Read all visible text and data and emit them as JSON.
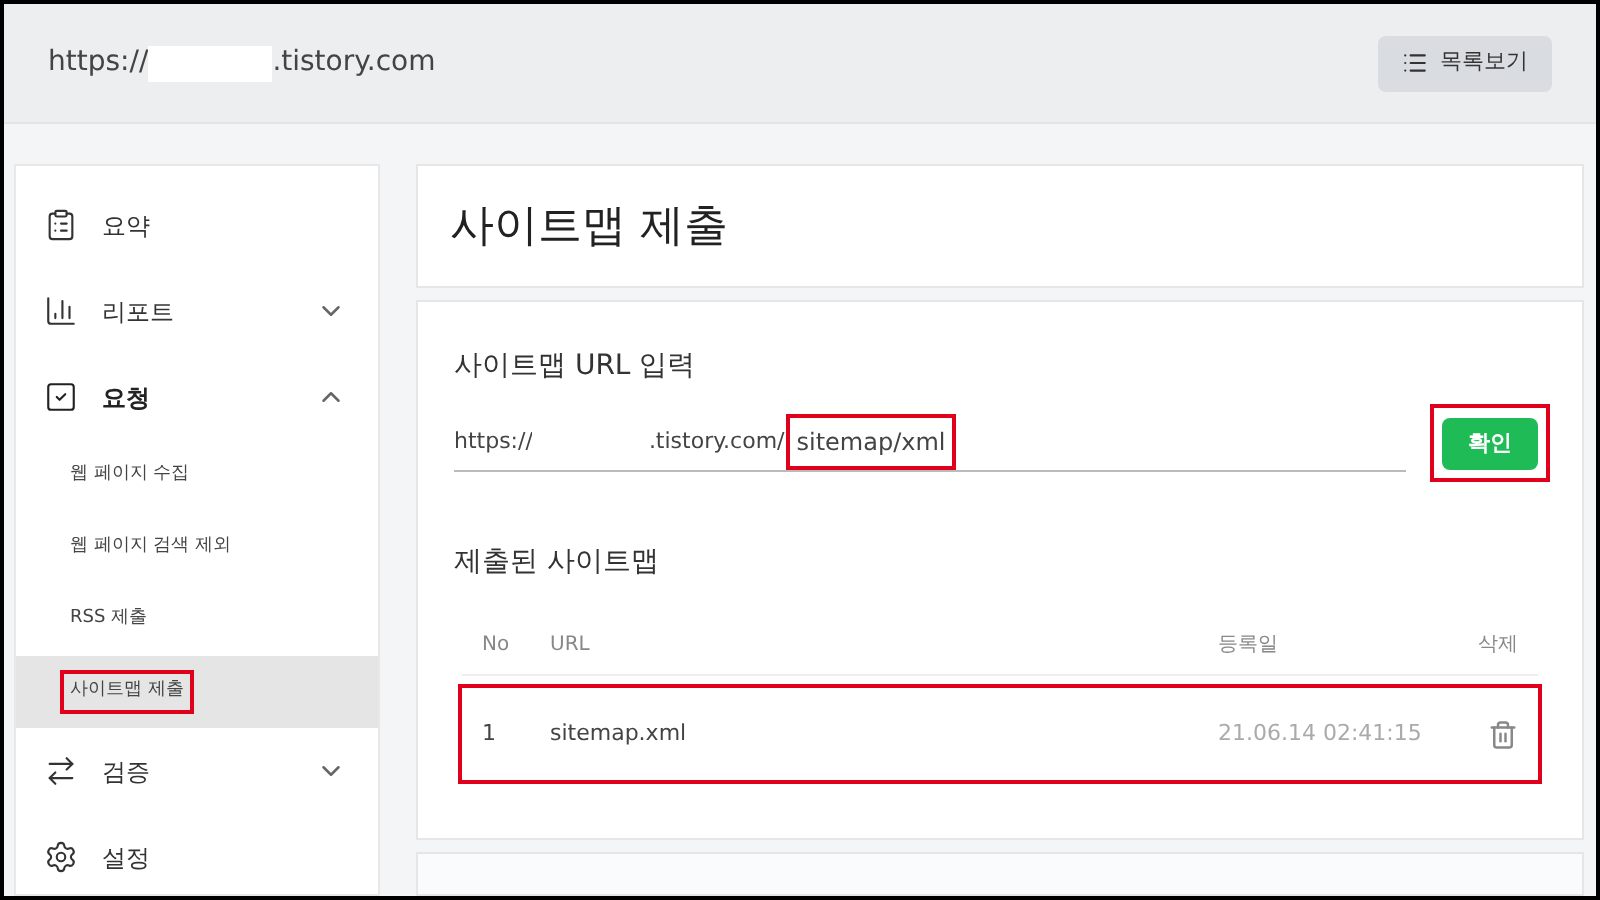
{
  "header": {
    "url_prefix": "https://",
    "url_suffix": ".tistory.com",
    "list_button": "목록보기"
  },
  "sidebar": {
    "items": [
      {
        "label": "요약",
        "kind": "summary"
      },
      {
        "label": "리포트",
        "kind": "report",
        "expanded": false
      },
      {
        "label": "요청",
        "kind": "request",
        "expanded": true,
        "children": [
          {
            "label": "웹 페이지 수집",
            "selected": false,
            "highlighted": false
          },
          {
            "label": "웹 페이지 검색 제외",
            "selected": false,
            "highlighted": false
          },
          {
            "label": "RSS 제출",
            "selected": false,
            "highlighted": false
          },
          {
            "label": "사이트맵 제출",
            "selected": true,
            "highlighted": true
          }
        ]
      },
      {
        "label": "검증",
        "kind": "verify",
        "expanded": false
      },
      {
        "label": "설정",
        "kind": "settings"
      }
    ]
  },
  "page_title": "사이트맵 제출",
  "url_input": {
    "label": "사이트맵 URL 입력",
    "prefix": "https://",
    "suffix": ".tistory.com/",
    "value": "sitemap/xml",
    "highlighted": true,
    "button": "확인",
    "button_highlighted": true
  },
  "submitted": {
    "title": "제출된 사이트맵",
    "columns": [
      "No",
      "URL",
      "등록일",
      "삭제"
    ],
    "rows": [
      {
        "no": "1",
        "url": "sitemap.xml",
        "date": "21.06.14 02:41:15",
        "highlighted": true
      }
    ]
  }
}
